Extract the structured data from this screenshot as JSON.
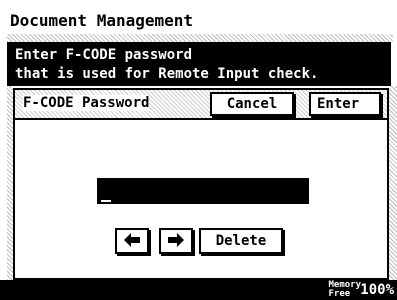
{
  "header": {
    "title": "Document Management"
  },
  "message": {
    "line1": "Enter F-CODE password",
    "line2": "that is used for Remote Input check."
  },
  "form": {
    "field_label": "F-CODE Password",
    "cancel_label": "Cancel",
    "enter_label": "Enter",
    "password_value": "",
    "delete_label": "Delete",
    "left_arrow_icon": "arrow-left-icon",
    "right_arrow_icon": "arrow-right-icon"
  },
  "status": {
    "memory_label": "Memory\nFree",
    "memory_value": "100%"
  },
  "colors": {
    "foreground": "#000000",
    "background": "#ffffff"
  }
}
